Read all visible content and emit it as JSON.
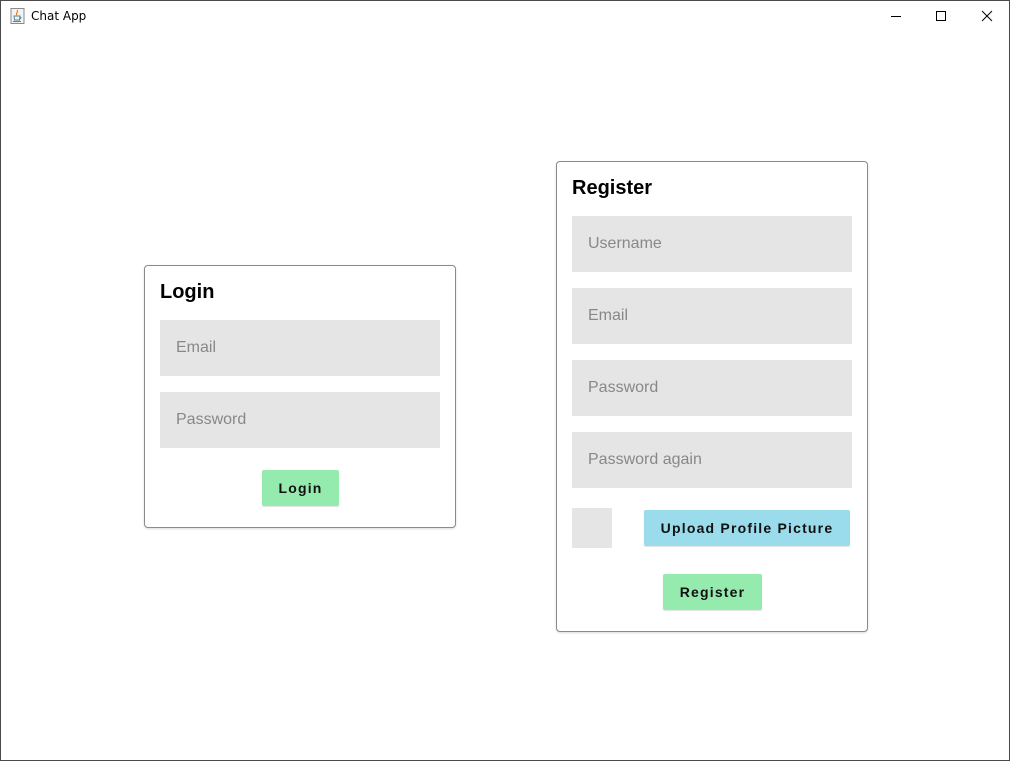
{
  "window": {
    "title": "Chat App"
  },
  "login": {
    "title": "Login",
    "email_placeholder": "Email",
    "password_placeholder": "Password",
    "submit_label": "Login"
  },
  "register": {
    "title": "Register",
    "username_placeholder": "Username",
    "email_placeholder": "Email",
    "password_placeholder": "Password",
    "password_again_placeholder": "Password again",
    "upload_label": "Upload Profile Picture",
    "submit_label": "Register"
  },
  "colors": {
    "field_bg": "#e5e5e5",
    "green_button": "#95eaae",
    "blue_button": "#9adbec",
    "card_border": "#8a8a8a"
  },
  "icons": {
    "app": "java-coffee-cup-icon",
    "minimize": "minimize-icon",
    "maximize": "maximize-icon",
    "close": "close-icon"
  }
}
